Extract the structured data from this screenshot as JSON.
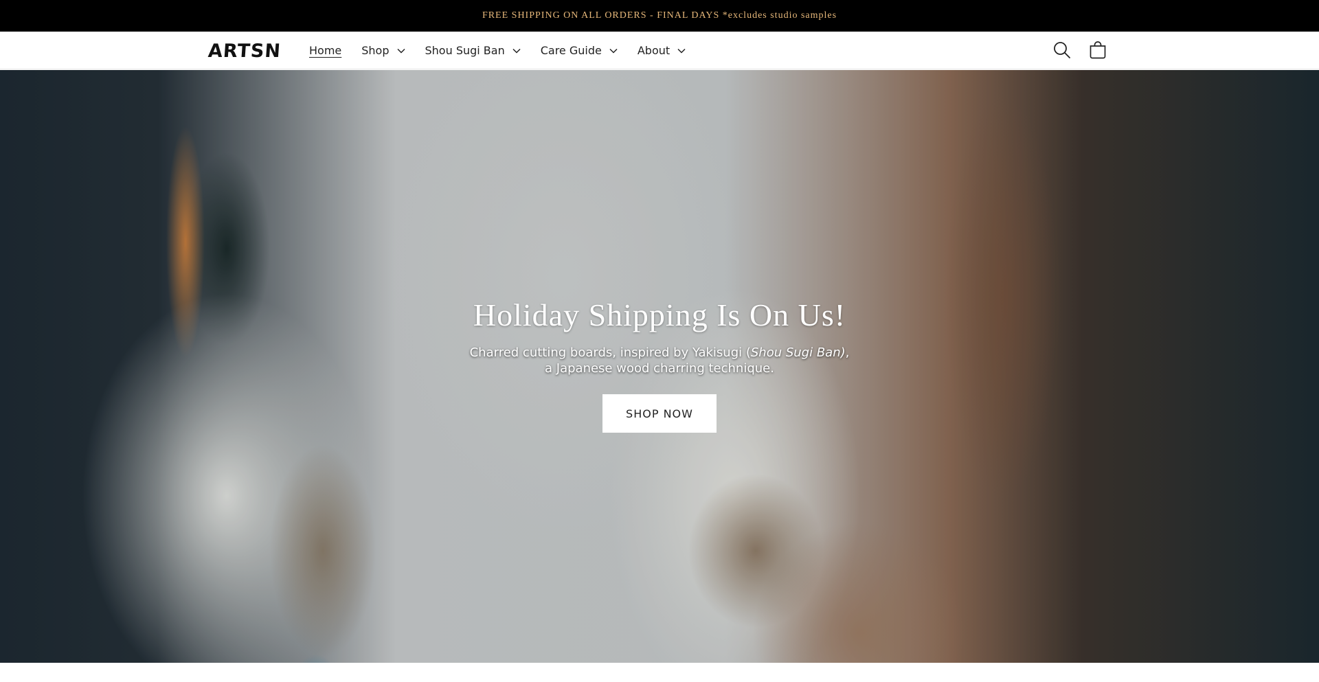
{
  "announcement": {
    "text": "FREE SHIPPING ON ALL ORDERS - FINAL DAYS *excludes studio samples",
    "color": "#e8b97b"
  },
  "header": {
    "logo": "ARTSN",
    "nav": [
      {
        "label": "Home",
        "has_dropdown": false,
        "active": true
      },
      {
        "label": "Shop",
        "has_dropdown": true
      },
      {
        "label": "Shou Sugi Ban",
        "has_dropdown": true
      },
      {
        "label": "Care Guide",
        "has_dropdown": true
      },
      {
        "label": "About",
        "has_dropdown": true
      }
    ],
    "icons": {
      "search": "search-icon",
      "cart": "cart-icon",
      "chevron": "chevron-down-icon"
    }
  },
  "hero": {
    "title": "Holiday Shipping Is On Us!",
    "subtitle_before": "Charred cutting boards, inspired by Yakisugi (",
    "subtitle_emphasis": "Shou Sugi Ban)",
    "subtitle_after": ", a Japanese wood charring technique.",
    "button_label": "SHOP NOW"
  }
}
